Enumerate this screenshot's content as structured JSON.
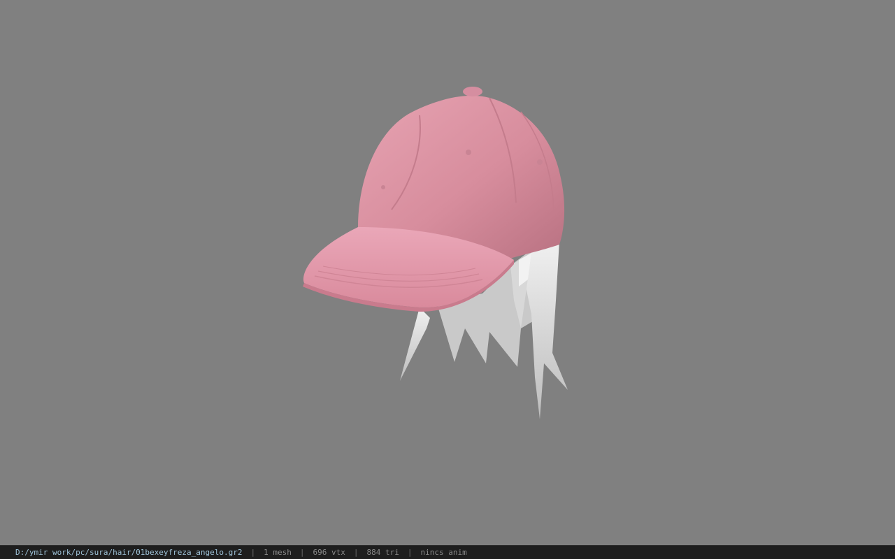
{
  "viewport": {
    "background_color": "#808080",
    "model": {
      "cap_color": "#d98f9f",
      "brim_color": "#e79eb0",
      "hair_color": "#e4e4e4"
    }
  },
  "status_bar": {
    "file_path": "D:/ymir work/pc/sura/hair/01bexeyfreza_angelo.gr2",
    "mesh_count": "1 mesh",
    "vertex_count": "696 vtx",
    "triangle_count": "884 tri",
    "anim_status": "nincs anim",
    "separator": "|"
  }
}
